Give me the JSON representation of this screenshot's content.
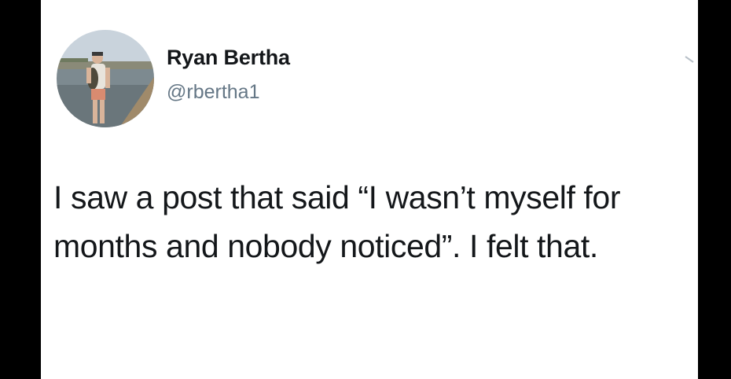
{
  "author": {
    "name": "Ryan Bertha",
    "handle": "@rbertha1",
    "avatar_icon": "profile-photo-person-holding-fish"
  },
  "tweet": {
    "text": "I saw a post that said “I wasn’t myself for months and nobody noticed”. I felt that."
  },
  "icons": {
    "menu": "chevron-down-icon"
  },
  "colors": {
    "frame": "#000000",
    "card": "#ffffff",
    "name": "#14171a",
    "handle": "#657786",
    "text": "#14171a"
  }
}
